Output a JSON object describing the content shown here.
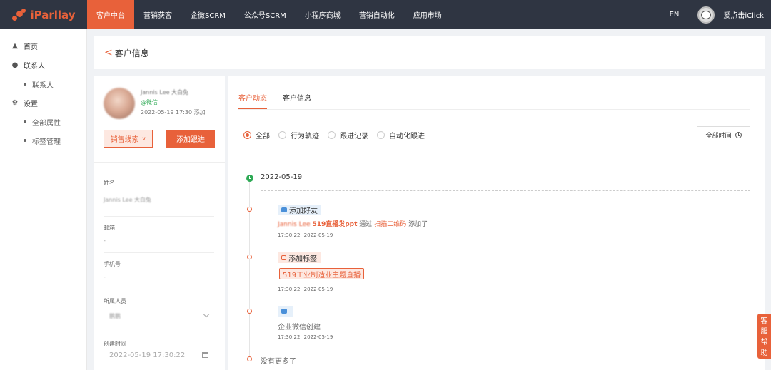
{
  "brand": {
    "name": "iParllay",
    "accent": "#e8613a"
  },
  "nav": {
    "items": [
      {
        "label": "客户中台",
        "active": true
      },
      {
        "label": "营销获客"
      },
      {
        "label": "企微SCRM"
      },
      {
        "label": "公众号SCRM"
      },
      {
        "label": "小程序商城"
      },
      {
        "label": "营销自动化"
      },
      {
        "label": "应用市场"
      }
    ],
    "lang": "EN",
    "user": "爱点击iClick"
  },
  "sidebar": {
    "home": "首页",
    "contacts": "联系人",
    "contacts_sub": "联系人",
    "settings": "设置",
    "settings_sub1": "全部属性",
    "settings_sub2": "标签管理"
  },
  "page": {
    "title": "客户信息",
    "back_icon": "<"
  },
  "customer": {
    "name": "Jannis Lee 大白兔",
    "source": "@微信",
    "added": "2022-05-19 17:30 添加",
    "lead_button": "销售线索",
    "follow_button": "添加跟进"
  },
  "fields": {
    "name_label": "姓名",
    "name_value": "Jannis Lee 大白兔",
    "email_label": "邮箱",
    "email_value": "-",
    "phone_label": "手机号",
    "phone_value": "-",
    "owner_label": "所属人员",
    "owner_value": "鹏鹏",
    "created_label": "创建时间",
    "created_value": "2022-05-19 17:30:22"
  },
  "tabs": {
    "activity": "客户动态",
    "info": "客户信息"
  },
  "filters": {
    "all": "全部",
    "behavior": "行为轨迹",
    "followup": "跟进记录",
    "auto": "自动化跟进",
    "time_button": "全部时间"
  },
  "timeline": {
    "date": "2022-05-19",
    "ev1": {
      "tag": "添加好友",
      "name": "Jannis Lee",
      "campaign": "519直播发ppt",
      "via": "通过",
      "method": "扫描二维码",
      "action": "添加了",
      "time": "17:30:22 2022-05-19"
    },
    "ev2": {
      "tag": "添加标签",
      "label": "519工业制造业主题直播",
      "time": "17:30:22 2022-05-19"
    },
    "ev3": {
      "text": "企业微信创建",
      "time": "17:30:22 2022-05-19"
    },
    "end": "没有更多了"
  },
  "help": {
    "label": "客服帮助"
  }
}
